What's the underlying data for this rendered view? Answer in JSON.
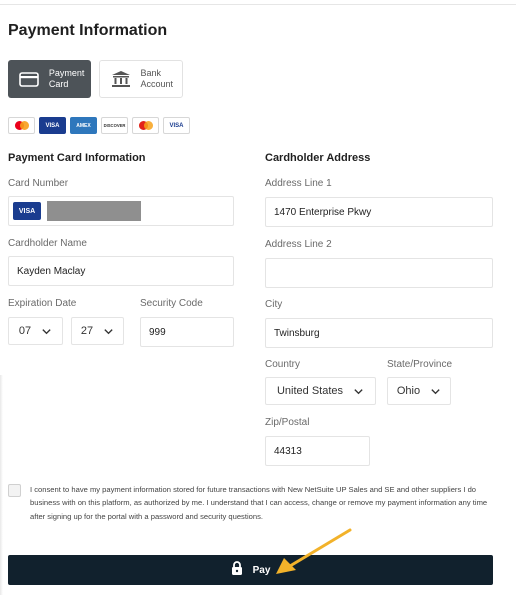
{
  "page": {
    "title": "Payment Information"
  },
  "payment_methods": [
    {
      "line1": "Payment",
      "line2": "Card",
      "icon": "card-icon",
      "active": true
    },
    {
      "line1": "Bank",
      "line2": "Account",
      "icon": "bank-icon",
      "active": false
    }
  ],
  "accepted_cards": [
    {
      "name": "mastercard-icon",
      "label": ""
    },
    {
      "name": "visa-icon",
      "label": "VISA"
    },
    {
      "name": "amex-icon",
      "label": "AMEX"
    },
    {
      "name": "discover-icon",
      "label": "DISCOVER"
    },
    {
      "name": "maestro-icon",
      "label": ""
    },
    {
      "name": "visa-electron-icon",
      "label": "VISA"
    }
  ],
  "card_info": {
    "heading": "Payment Card Information",
    "card_number_label": "Card Number",
    "card_brand": "VISA",
    "cardholder_label": "Cardholder Name",
    "cardholder_value": "Kayden Maclay",
    "expiration_label": "Expiration Date",
    "exp_month": "07",
    "exp_year": "27",
    "security_label": "Security Code",
    "security_value": "999"
  },
  "address": {
    "heading": "Cardholder Address",
    "line1_label": "Address Line 1",
    "line1_value": "1470 Enterprise Pkwy",
    "line2_label": "Address Line 2",
    "line2_value": "",
    "city_label": "City",
    "city_value": "Twinsburg",
    "country_label": "Country",
    "country_value": "United States",
    "state_label": "State/Province",
    "state_value": "Ohio",
    "zip_label": "Zip/Postal",
    "zip_value": "44313"
  },
  "consent": {
    "text": "I consent to have my payment information stored for future transactions with New NetSuite UP Sales and SE and other suppliers I do business with on this platform, as authorized by me. I understand that I can access, change or remove my payment information any time after signing up for the portal with a password and security questions."
  },
  "pay_button": {
    "label": "Pay"
  },
  "colors": {
    "primary_dark": "#11212d",
    "active_tab": "#4d5358",
    "annotation_arrow": "#f2b22a"
  }
}
